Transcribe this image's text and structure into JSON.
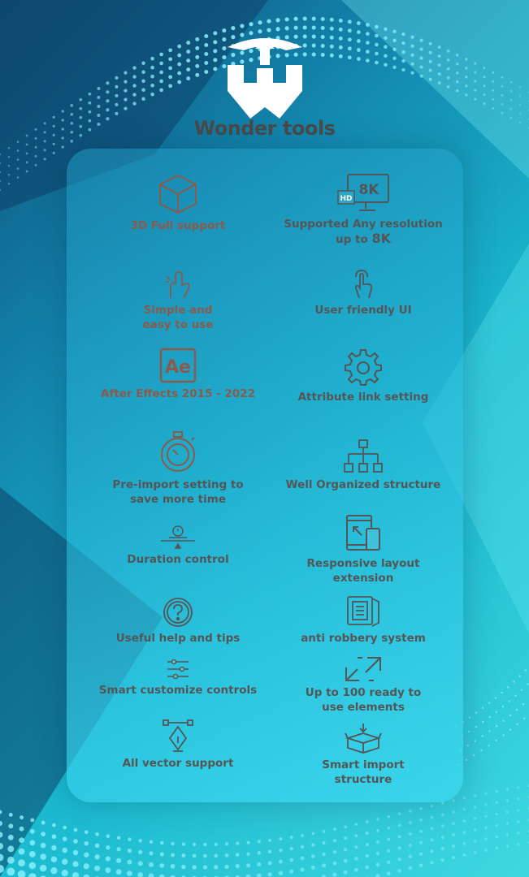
{
  "brand": {
    "name": "Wonder tools",
    "logo_icon": "wonder-tools-logo"
  },
  "colors": {
    "text": "#555555",
    "brand_text": "#4a4a4a",
    "logo": "#ffffff",
    "accent": "#1ab8cf"
  },
  "features": {
    "left": [
      {
        "label": "3D Full support",
        "icon": "cube-icon"
      },
      {
        "label": "Simple and\neasy to use",
        "icon": "hand-snap-icon"
      },
      {
        "label": "After Effects 2015 - 2022",
        "icon": "after-effects-icon",
        "icon_text": "Ae"
      },
      {
        "label": "Pre-import setting to\nsave more time",
        "icon": "stopwatch-icon"
      },
      {
        "label": "Duration control",
        "icon": "duration-timer-icon"
      },
      {
        "label": "Useful help and tips",
        "icon": "question-icon"
      },
      {
        "label": "Smart customize controls",
        "icon": "sliders-icon"
      },
      {
        "label": "All vector support",
        "icon": "pen-tool-icon"
      }
    ],
    "right": [
      {
        "label": "Supported Any resolution",
        "label2_prefix": "up to ",
        "label2_big": "8K",
        "icon": "monitor-8k-icon",
        "icon_text": "8K",
        "icon_text2": "HD"
      },
      {
        "label": "User friendly UI",
        "icon": "touch-hand-icon"
      },
      {
        "label": "Attribute link setting",
        "icon": "gear-icon"
      },
      {
        "label": "Well Organized structure",
        "icon": "hierarchy-icon"
      },
      {
        "label": "Responsive layout\nextension",
        "icon": "responsive-devices-icon"
      },
      {
        "label": "anti robbery system",
        "icon": "safe-icon"
      },
      {
        "label": "Up to 100 ready to\nuse elements",
        "icon": "expand-arrows-icon"
      },
      {
        "label": "Smart import\nstructure",
        "icon": "open-box-icon"
      }
    ]
  }
}
